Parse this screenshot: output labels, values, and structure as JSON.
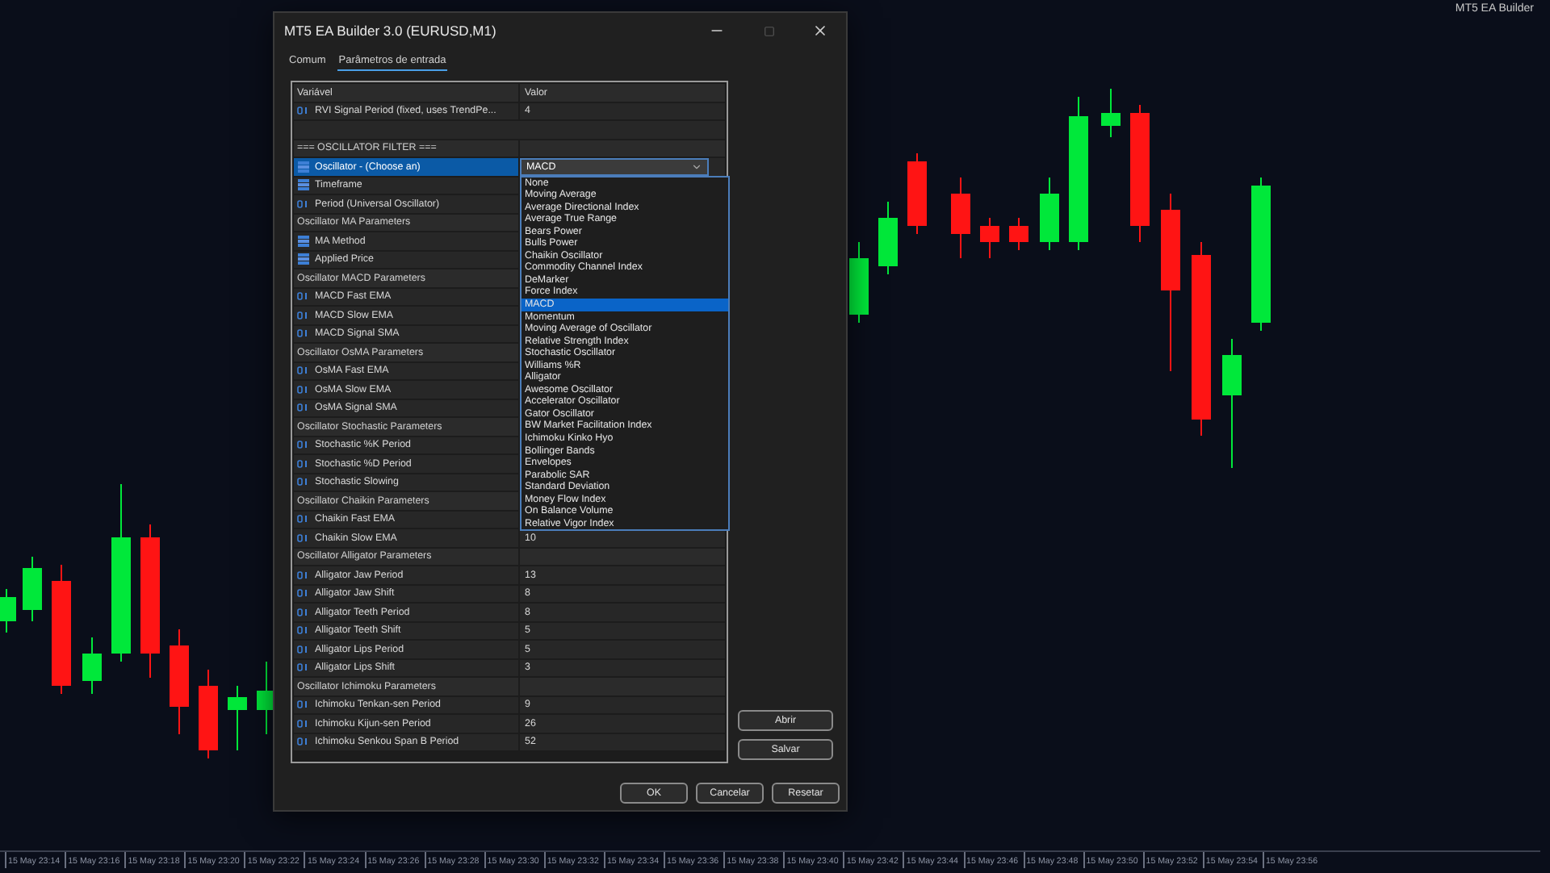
{
  "window": {
    "title": "MT5 EA Builder 3.0 (EURUSD,M1)"
  },
  "chart_label": "MT5 EA Builder",
  "tabs": [
    {
      "label": "Comum",
      "selected": false
    },
    {
      "label": "Parâmetros de entrada",
      "selected": true
    }
  ],
  "table": {
    "columns": [
      "Variável",
      "Valor"
    ],
    "rows": [
      {
        "kind": "int",
        "variable": "RVI Signal Period (fixed, uses TrendPe...",
        "value": "4",
        "selected": false
      },
      {
        "kind": "blank",
        "selected": false
      },
      {
        "kind": "header",
        "variable": "=== OSCILLATOR FILTER ===",
        "selected": false
      },
      {
        "kind": "enum",
        "variable": "Oscillator - (Choose an)",
        "value": "MACD",
        "selected": true,
        "expanded": true
      },
      {
        "kind": "enum",
        "variable": "Timeframe",
        "selected": false
      },
      {
        "kind": "int",
        "variable": "Period (Universal Oscillator)",
        "selected": false
      },
      {
        "kind": "header",
        "variable": "Oscillator MA Parameters",
        "selected": false
      },
      {
        "kind": "enum",
        "variable": "MA Method",
        "selected": false
      },
      {
        "kind": "enum",
        "variable": "Applied Price",
        "selected": false
      },
      {
        "kind": "header",
        "variable": "Oscillator MACD Parameters",
        "selected": false
      },
      {
        "kind": "int",
        "variable": "MACD Fast EMA",
        "selected": false
      },
      {
        "kind": "int",
        "variable": "MACD Slow EMA",
        "selected": false
      },
      {
        "kind": "int",
        "variable": "MACD Signal SMA",
        "selected": false
      },
      {
        "kind": "header",
        "variable": "Oscillator OsMA Parameters",
        "selected": false
      },
      {
        "kind": "int",
        "variable": "OsMA Fast EMA",
        "selected": false
      },
      {
        "kind": "int",
        "variable": "OsMA Slow EMA",
        "selected": false
      },
      {
        "kind": "int",
        "variable": "OsMA Signal SMA",
        "selected": false
      },
      {
        "kind": "header",
        "variable": "Oscillator Stochastic Parameters",
        "selected": false
      },
      {
        "kind": "int",
        "variable": "Stochastic %K Period",
        "selected": false
      },
      {
        "kind": "int",
        "variable": "Stochastic %D Period",
        "selected": false
      },
      {
        "kind": "int",
        "variable": "Stochastic Slowing",
        "selected": false
      },
      {
        "kind": "header",
        "variable": "Oscillator Chaikin Parameters",
        "selected": false
      },
      {
        "kind": "int",
        "variable": "Chaikin Fast EMA",
        "selected": false
      },
      {
        "kind": "int",
        "variable": "Chaikin Slow EMA",
        "value": "10",
        "selected": false
      },
      {
        "kind": "header",
        "variable": "Oscillator Alligator Parameters",
        "selected": false
      },
      {
        "kind": "int",
        "variable": "Alligator Jaw Period",
        "value": "13",
        "selected": false
      },
      {
        "kind": "int",
        "variable": "Alligator Jaw Shift",
        "value": "8",
        "selected": false
      },
      {
        "kind": "int",
        "variable": "Alligator Teeth Period",
        "value": "8",
        "selected": false
      },
      {
        "kind": "int",
        "variable": "Alligator Teeth Shift",
        "value": "5",
        "selected": false
      },
      {
        "kind": "int",
        "variable": "Alligator Lips Period",
        "value": "5",
        "selected": false
      },
      {
        "kind": "int",
        "variable": "Alligator Lips Shift",
        "value": "3",
        "selected": false
      },
      {
        "kind": "header",
        "variable": "Oscillator Ichimoku Parameters",
        "selected": false
      },
      {
        "kind": "int",
        "variable": "Ichimoku Tenkan-sen Period",
        "value": "9",
        "selected": false
      },
      {
        "kind": "int",
        "variable": "Ichimoku Kijun-sen Period",
        "value": "26",
        "selected": false
      },
      {
        "kind": "int",
        "variable": "Ichimoku Senkou Span B Period",
        "value": "52",
        "selected": false
      }
    ]
  },
  "dropdown": {
    "options": [
      {
        "label": "None",
        "selected": false
      },
      {
        "label": "Moving Average",
        "selected": false
      },
      {
        "label": "Average Directional Index",
        "selected": false
      },
      {
        "label": "Average True Range",
        "selected": false
      },
      {
        "label": "Bears Power",
        "selected": false
      },
      {
        "label": "Bulls Power",
        "selected": false
      },
      {
        "label": "Chaikin Oscillator",
        "selected": false
      },
      {
        "label": "Commodity Channel Index",
        "selected": false
      },
      {
        "label": "DeMarker",
        "selected": false
      },
      {
        "label": "Force Index",
        "selected": false
      },
      {
        "label": "MACD",
        "selected": true
      },
      {
        "label": "Momentum",
        "selected": false
      },
      {
        "label": "Moving Average of Oscillator",
        "selected": false
      },
      {
        "label": "Relative Strength Index",
        "selected": false
      },
      {
        "label": "Stochastic Oscillator",
        "selected": false
      },
      {
        "label": "Williams %R",
        "selected": false
      },
      {
        "label": "Alligator",
        "selected": false
      },
      {
        "label": "Awesome Oscillator",
        "selected": false
      },
      {
        "label": "Accelerator Oscillator",
        "selected": false
      },
      {
        "label": "Gator Oscillator",
        "selected": false
      },
      {
        "label": "BW Market Facilitation Index",
        "selected": false
      },
      {
        "label": "Ichimoku Kinko Hyo",
        "selected": false
      },
      {
        "label": "Bollinger Bands",
        "selected": false
      },
      {
        "label": "Envelopes",
        "selected": false
      },
      {
        "label": "Parabolic SAR",
        "selected": false
      },
      {
        "label": "Standard Deviation",
        "selected": false
      },
      {
        "label": "Money Flow Index",
        "selected": false
      },
      {
        "label": "On Balance Volume",
        "selected": false
      },
      {
        "label": "Relative Vigor Index",
        "selected": false
      }
    ]
  },
  "side_buttons": [
    "Abrir",
    "Salvar"
  ],
  "buttons": [
    "OK",
    "Cancelar",
    "Resetar"
  ],
  "time_axis": [
    "15 May 23:14",
    "15 May 23:16",
    "15 May 23:18",
    "15 May 23:20",
    "15 May 23:22",
    "15 May 23:24",
    "15 May 23:26",
    "15 May 23:28",
    "15 May 23:30",
    "15 May 23:32",
    "15 May 23:34",
    "15 May 23:36",
    "15 May 23:38",
    "15 May 23:40",
    "15 May 23:42",
    "15 May 23:44",
    "15 May 23:46",
    "15 May 23:48",
    "15 May 23:50",
    "15 May 23:52",
    "15 May 23:54",
    "15 May 23:56"
  ]
}
